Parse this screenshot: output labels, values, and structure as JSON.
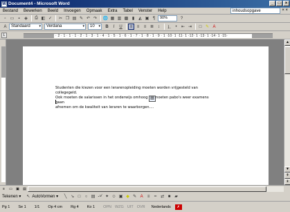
{
  "window": {
    "title": "Document4 - Microsoft Word"
  },
  "menu": {
    "items": [
      "Bestand",
      "Bewerken",
      "Beeld",
      "Invoegen",
      "Opmaak",
      "Extra",
      "Tabel",
      "Venster",
      "Help"
    ],
    "help_box": "inhoudsopgave",
    "close_glyph": "× ×"
  },
  "toolbar_standard": {
    "zoom": "90%",
    "icons": [
      "new-icon",
      "open-icon",
      "save-icon",
      "print-icon",
      "print-preview-icon",
      "spelling-icon",
      "cut-icon",
      "copy-icon",
      "paste-icon",
      "format-painter-icon",
      "undo-icon",
      "redo-icon",
      "hyperlink-icon",
      "tables-icon",
      "insert-table-icon",
      "excel-icon",
      "columns-icon",
      "drawing-icon",
      "document-map-icon",
      "show-hide-icon",
      "help-icon"
    ]
  },
  "toolbar_formatting": {
    "style": "Standaard",
    "font": "Verdana",
    "size": "10",
    "bold": "B",
    "italic": "I",
    "underline": "U"
  },
  "ruler": {
    "ticks": "· 2 · 1 · 1 · 1 · 2 · 1 · 3 · 1 · 4 · 1 · 5 · 1 · 6 · 1 · 7 · 1 · 8 · 1 · 9 · 1 ·10· 1 ·11· 1 ·12· 1 ·13· 1 ·14· 1 ·15·"
  },
  "document": {
    "lines": [
      "Studenten die kiezen voor een lerarenopleiding moeten worden vrijgesteld van collegegeld.",
      "Ook moeten de salarissen in het onderwijs omhoog en moeten pabo's weer examens gaan",
      "afnemen om de kwaliteit van leraren te waarborgen…."
    ]
  },
  "drawbar": {
    "draw_label": "Tekenen ▾",
    "autoshapes_label": "AutoVormen ▾"
  },
  "status": {
    "page": "Pg 1",
    "section": "Se 1",
    "pages": "1/1",
    "at": "Op 4 cm",
    "line": "Rg 4",
    "col": "Ko 1",
    "rec": "OPN",
    "trk": "WZG",
    "ext": "UIT",
    "ovr": "OVR",
    "language": "Nederlands"
  }
}
